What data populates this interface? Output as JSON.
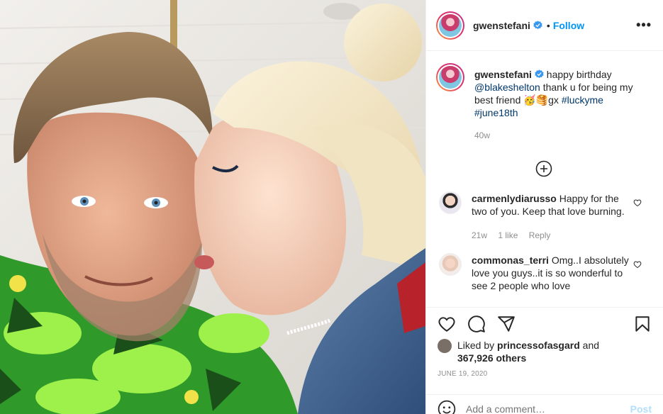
{
  "header": {
    "username": "gwenstefani",
    "dot": "•",
    "follow_label": "Follow",
    "more_label": "•••"
  },
  "caption": {
    "username": "gwenstefani",
    "text_1": "happy birthday",
    "mention": "@blakeshelton",
    "text_2": "thank u for being my best friend",
    "emoji": "🥳🥞",
    "text_3": "gx",
    "tag_1": "#luckyme",
    "tag_2": "#june18th",
    "time": "40w"
  },
  "comments": [
    {
      "username": "carmenlydiarusso",
      "text": "Happy for the two of you. Keep that love burning.",
      "time": "21w",
      "likes": "1 like",
      "reply": "Reply"
    },
    {
      "username": "commonas_terri",
      "text": "Omg..I absolutely love you guys..it is so wonderful to see 2 people who love"
    }
  ],
  "likes": {
    "prefix": "Liked by",
    "user": "princessofasgard",
    "mid": "and",
    "count": "367,926 others"
  },
  "date": "JUNE 19, 2020",
  "add_comment": {
    "placeholder": "Add a comment…",
    "post_label": "Post"
  },
  "icons": [
    "verified-icon",
    "more-icon",
    "plus-circle-icon",
    "heart-icon",
    "comment-icon",
    "share-icon",
    "save-icon",
    "smile-icon"
  ],
  "colors": {
    "link": "#00376b",
    "follow": "#0095f6",
    "muted": "#8e8e8e",
    "post_disabled": "#b2dffc"
  }
}
